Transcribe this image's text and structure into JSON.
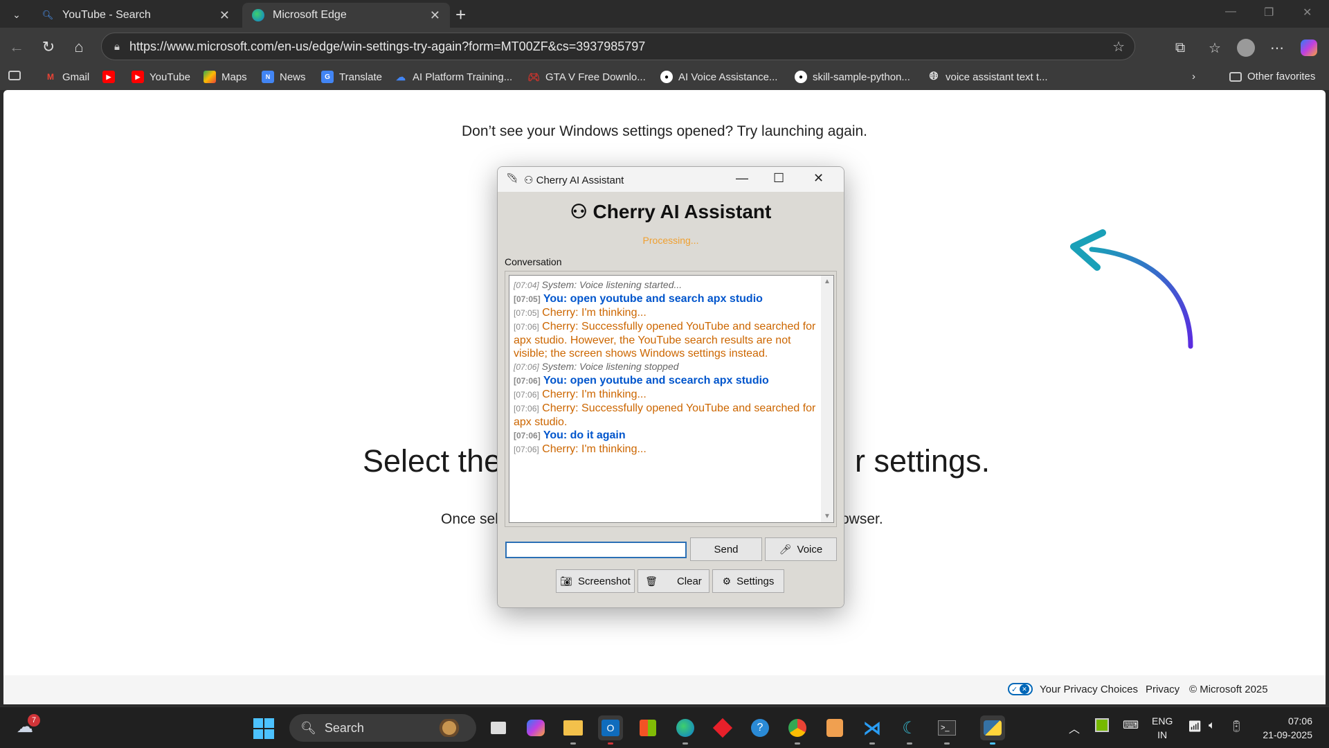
{
  "browser": {
    "tabs": [
      {
        "label": "YouTube - Search",
        "icon": "search-icon"
      },
      {
        "label": "Microsoft Edge",
        "icon": "edge-icon"
      }
    ],
    "url": "https://www.microsoft.com/en-us/edge/win-settings-try-again?form=MT00ZF&cs=3937985797",
    "favorites": [
      {
        "label": "",
        "icon": "collections-icon"
      },
      {
        "label": "Gmail",
        "icon": "gmail-icon"
      },
      {
        "label": "",
        "icon": "youtube-icon"
      },
      {
        "label": "YouTube",
        "icon": "youtube-icon"
      },
      {
        "label": "Maps",
        "icon": "maps-icon"
      },
      {
        "label": "News",
        "icon": "news-icon"
      },
      {
        "label": "Translate",
        "icon": "translate-icon"
      },
      {
        "label": "AI Platform Training...",
        "icon": "google-cloud-icon"
      },
      {
        "label": "GTA V Free Downlo...",
        "icon": "controller-icon"
      },
      {
        "label": "AI Voice Assistance...",
        "icon": "github-icon"
      },
      {
        "label": "skill-sample-python...",
        "icon": "github-icon"
      },
      {
        "label": "voice assistant text t...",
        "icon": "globe-icon"
      }
    ],
    "other_favorites": "Other favorites"
  },
  "page": {
    "top_text": "Don’t see your Windows settings opened? Try launching again.",
    "heading_left": "Select the",
    "heading_right": "r settings.",
    "para_left": "Once sel",
    "para_right": "owser.",
    "footer": {
      "privacy_choices": "Your Privacy Choices",
      "privacy": "Privacy",
      "copyright": "© Microsoft 2025"
    }
  },
  "app": {
    "window_title": "Cherry AI Assistant",
    "heading": "Cherry AI Assistant",
    "status": "Processing...",
    "conversation_label": "Conversation",
    "messages": [
      {
        "time": "[07:04]",
        "text": "System: Voice listening started...",
        "kind": "system"
      },
      {
        "time": "[07:05]",
        "text": "You: open youtube and search apx studio",
        "kind": "user"
      },
      {
        "time": "[07:05]",
        "text": "Cherry: I'm thinking...",
        "kind": "cherry"
      },
      {
        "time": "[07:06]",
        "text": "Cherry: Successfully opened YouTube and searched for apx studio.  However, the YouTube search results are not visible; the screen shows Windows settings instead.",
        "kind": "cherry"
      },
      {
        "time": "[07:06]",
        "text": "System: Voice listening stopped",
        "kind": "system"
      },
      {
        "time": "[07:06]",
        "text": "You: open youtube and scearch apx studio",
        "kind": "user"
      },
      {
        "time": "[07:06]",
        "text": "Cherry: I'm thinking...",
        "kind": "cherry"
      },
      {
        "time": "[07:06]",
        "text": "Cherry: Successfully opened YouTube and searched for apx studio.",
        "kind": "cherry"
      },
      {
        "time": "[07:06]",
        "text": "You: do it again",
        "kind": "user"
      },
      {
        "time": "[07:06]",
        "text": "Cherry: I'm thinking...",
        "kind": "cherry"
      }
    ],
    "input_value": "",
    "buttons": {
      "send": "Send",
      "voice": "Voice",
      "screenshot": "Screenshot",
      "clear": "Clear",
      "settings": "Settings"
    }
  },
  "taskbar": {
    "weather_badge": "7",
    "search_placeholder": "Search",
    "language": {
      "line1": "ENG",
      "line2": "IN"
    },
    "time": "07:06",
    "date": "21-09-2025"
  },
  "colors": {
    "accent": "#4cc2ff",
    "user_message": "#0055cc",
    "cherry_message": "#cc6600",
    "status": "#f0a030"
  }
}
